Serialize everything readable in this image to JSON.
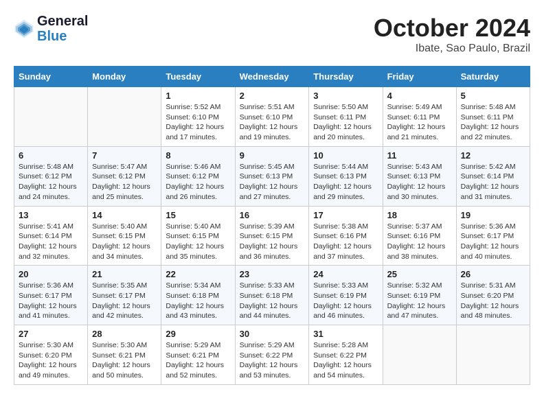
{
  "header": {
    "logo_general": "General",
    "logo_blue": "Blue",
    "month_title": "October 2024",
    "subtitle": "Ibate, Sao Paulo, Brazil"
  },
  "days_of_week": [
    "Sunday",
    "Monday",
    "Tuesday",
    "Wednesday",
    "Thursday",
    "Friday",
    "Saturday"
  ],
  "weeks": [
    [
      {
        "day": "",
        "info": ""
      },
      {
        "day": "",
        "info": ""
      },
      {
        "day": "1",
        "info": "Sunrise: 5:52 AM\nSunset: 6:10 PM\nDaylight: 12 hours and 17 minutes."
      },
      {
        "day": "2",
        "info": "Sunrise: 5:51 AM\nSunset: 6:10 PM\nDaylight: 12 hours and 19 minutes."
      },
      {
        "day": "3",
        "info": "Sunrise: 5:50 AM\nSunset: 6:11 PM\nDaylight: 12 hours and 20 minutes."
      },
      {
        "day": "4",
        "info": "Sunrise: 5:49 AM\nSunset: 6:11 PM\nDaylight: 12 hours and 21 minutes."
      },
      {
        "day": "5",
        "info": "Sunrise: 5:48 AM\nSunset: 6:11 PM\nDaylight: 12 hours and 22 minutes."
      }
    ],
    [
      {
        "day": "6",
        "info": "Sunrise: 5:48 AM\nSunset: 6:12 PM\nDaylight: 12 hours and 24 minutes."
      },
      {
        "day": "7",
        "info": "Sunrise: 5:47 AM\nSunset: 6:12 PM\nDaylight: 12 hours and 25 minutes."
      },
      {
        "day": "8",
        "info": "Sunrise: 5:46 AM\nSunset: 6:12 PM\nDaylight: 12 hours and 26 minutes."
      },
      {
        "day": "9",
        "info": "Sunrise: 5:45 AM\nSunset: 6:13 PM\nDaylight: 12 hours and 27 minutes."
      },
      {
        "day": "10",
        "info": "Sunrise: 5:44 AM\nSunset: 6:13 PM\nDaylight: 12 hours and 29 minutes."
      },
      {
        "day": "11",
        "info": "Sunrise: 5:43 AM\nSunset: 6:13 PM\nDaylight: 12 hours and 30 minutes."
      },
      {
        "day": "12",
        "info": "Sunrise: 5:42 AM\nSunset: 6:14 PM\nDaylight: 12 hours and 31 minutes."
      }
    ],
    [
      {
        "day": "13",
        "info": "Sunrise: 5:41 AM\nSunset: 6:14 PM\nDaylight: 12 hours and 32 minutes."
      },
      {
        "day": "14",
        "info": "Sunrise: 5:40 AM\nSunset: 6:15 PM\nDaylight: 12 hours and 34 minutes."
      },
      {
        "day": "15",
        "info": "Sunrise: 5:40 AM\nSunset: 6:15 PM\nDaylight: 12 hours and 35 minutes."
      },
      {
        "day": "16",
        "info": "Sunrise: 5:39 AM\nSunset: 6:15 PM\nDaylight: 12 hours and 36 minutes."
      },
      {
        "day": "17",
        "info": "Sunrise: 5:38 AM\nSunset: 6:16 PM\nDaylight: 12 hours and 37 minutes."
      },
      {
        "day": "18",
        "info": "Sunrise: 5:37 AM\nSunset: 6:16 PM\nDaylight: 12 hours and 38 minutes."
      },
      {
        "day": "19",
        "info": "Sunrise: 5:36 AM\nSunset: 6:17 PM\nDaylight: 12 hours and 40 minutes."
      }
    ],
    [
      {
        "day": "20",
        "info": "Sunrise: 5:36 AM\nSunset: 6:17 PM\nDaylight: 12 hours and 41 minutes."
      },
      {
        "day": "21",
        "info": "Sunrise: 5:35 AM\nSunset: 6:17 PM\nDaylight: 12 hours and 42 minutes."
      },
      {
        "day": "22",
        "info": "Sunrise: 5:34 AM\nSunset: 6:18 PM\nDaylight: 12 hours and 43 minutes."
      },
      {
        "day": "23",
        "info": "Sunrise: 5:33 AM\nSunset: 6:18 PM\nDaylight: 12 hours and 44 minutes."
      },
      {
        "day": "24",
        "info": "Sunrise: 5:33 AM\nSunset: 6:19 PM\nDaylight: 12 hours and 46 minutes."
      },
      {
        "day": "25",
        "info": "Sunrise: 5:32 AM\nSunset: 6:19 PM\nDaylight: 12 hours and 47 minutes."
      },
      {
        "day": "26",
        "info": "Sunrise: 5:31 AM\nSunset: 6:20 PM\nDaylight: 12 hours and 48 minutes."
      }
    ],
    [
      {
        "day": "27",
        "info": "Sunrise: 5:30 AM\nSunset: 6:20 PM\nDaylight: 12 hours and 49 minutes."
      },
      {
        "day": "28",
        "info": "Sunrise: 5:30 AM\nSunset: 6:21 PM\nDaylight: 12 hours and 50 minutes."
      },
      {
        "day": "29",
        "info": "Sunrise: 5:29 AM\nSunset: 6:21 PM\nDaylight: 12 hours and 52 minutes."
      },
      {
        "day": "30",
        "info": "Sunrise: 5:29 AM\nSunset: 6:22 PM\nDaylight: 12 hours and 53 minutes."
      },
      {
        "day": "31",
        "info": "Sunrise: 5:28 AM\nSunset: 6:22 PM\nDaylight: 12 hours and 54 minutes."
      },
      {
        "day": "",
        "info": ""
      },
      {
        "day": "",
        "info": ""
      }
    ]
  ]
}
